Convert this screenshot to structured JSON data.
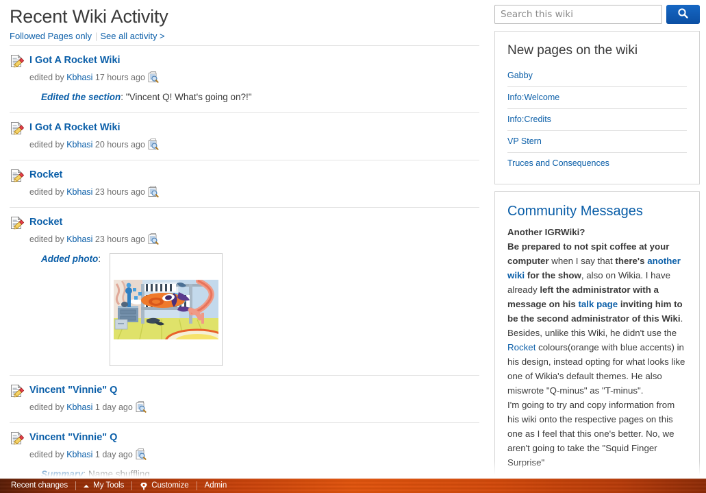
{
  "main": {
    "page_title": "Recent Wiki Activity",
    "subnav": {
      "followed_pages_label": "Followed Pages only",
      "see_all_label": "See all activity >"
    },
    "feed": [
      {
        "icon": "edit-page-icon",
        "title": "I Got A Rocket Wiki",
        "meta_prefix": "edited by ",
        "user": "Kbhasi",
        "time": " 17 hours ago",
        "diff_icon": "diff-compare-icon",
        "extra_label": "Edited the section",
        "extra_text": ": \"Vincent Q! What's going on?!\"",
        "photo": null
      },
      {
        "icon": "edit-page-icon",
        "title": "I Got A Rocket Wiki",
        "meta_prefix": "edited by ",
        "user": "Kbhasi",
        "time": " 20 hours ago",
        "diff_icon": "diff-compare-icon",
        "extra_label": null,
        "extra_text": null,
        "photo": null
      },
      {
        "icon": "edit-page-icon",
        "title": "Rocket",
        "meta_prefix": "edited by ",
        "user": "Kbhasi",
        "time": " 23 hours ago",
        "diff_icon": "diff-compare-icon",
        "extra_label": null,
        "extra_text": null,
        "photo": null
      },
      {
        "icon": "edit-page-icon",
        "title": "Rocket",
        "meta_prefix": "edited by ",
        "user": "Kbhasi",
        "time": " 23 hours ago",
        "diff_icon": "diff-compare-icon",
        "extra_label": "Added photo",
        "extra_text": ":",
        "photo": "rocket-in-bedroom-thumbnail"
      },
      {
        "icon": "edit-page-icon",
        "title": "Vincent \"Vinnie\" Q",
        "meta_prefix": "edited by ",
        "user": "Kbhasi",
        "time": " 1 day ago",
        "diff_icon": "diff-compare-icon",
        "extra_label": null,
        "extra_text": null,
        "photo": null
      },
      {
        "icon": "edit-page-icon",
        "title": "Vincent \"Vinnie\" Q",
        "meta_prefix": "edited by ",
        "user": "Kbhasi",
        "time": " 1 day ago",
        "diff_icon": "diff-compare-icon",
        "extra_label": "Summary",
        "extra_text": ": Name shuffling",
        "photo": null
      }
    ]
  },
  "right_rail": {
    "search": {
      "placeholder": "Search this wiki",
      "value": "",
      "button_icon": "search-icon"
    },
    "new_pages": {
      "title": "New pages on the wiki",
      "items": [
        "Gabby",
        "Info:Welcome",
        "Info:Credits",
        "VP Stern",
        "Truces and Consequences"
      ]
    },
    "community_messages": {
      "title": "Community Messages",
      "heading": "Another IGRWiki?",
      "paragraph_1_parts": [
        {
          "text": "Be prepared to not spit coffee at your computer",
          "bold": true,
          "link": false
        },
        {
          "text": " when I say that ",
          "bold": false,
          "link": false
        },
        {
          "text": "there's ",
          "bold": true,
          "link": false
        },
        {
          "text": "another wiki",
          "bold": true,
          "link": true
        },
        {
          "text": " for the show",
          "bold": true,
          "link": false
        },
        {
          "text": ", also on Wikia. I have already ",
          "bold": false,
          "link": false
        },
        {
          "text": "left the administrator with a message on his ",
          "bold": true,
          "link": false
        },
        {
          "text": "talk page",
          "bold": true,
          "link": true
        },
        {
          "text": " inviting him to be the second administrator of this Wiki",
          "bold": true,
          "link": false
        },
        {
          "text": ". Besides, unlike this Wiki, he didn't use the ",
          "bold": false,
          "link": false
        },
        {
          "text": "Rocket",
          "bold": false,
          "link": true
        },
        {
          "text": " colours(orange with blue accents) in his design, instead opting for what looks like one of Wikia's default themes. He also miswrote \"Q-minus\" as \"T-minus\".",
          "bold": false,
          "link": false
        }
      ],
      "paragraph_2": "I'm going to try and copy information from his wiki onto the respective pages on this one as I feel that this one's better. No, we aren't going to take the \"Squid Finger Surprise\""
    }
  },
  "toolbar": {
    "recent_changes_label": "Recent changes",
    "my_tools_label": "My Tools",
    "customize_label": "Customize",
    "admin_label": "Admin",
    "caret_icon": "caret-up-icon",
    "gear_icon": "gear-icon"
  }
}
